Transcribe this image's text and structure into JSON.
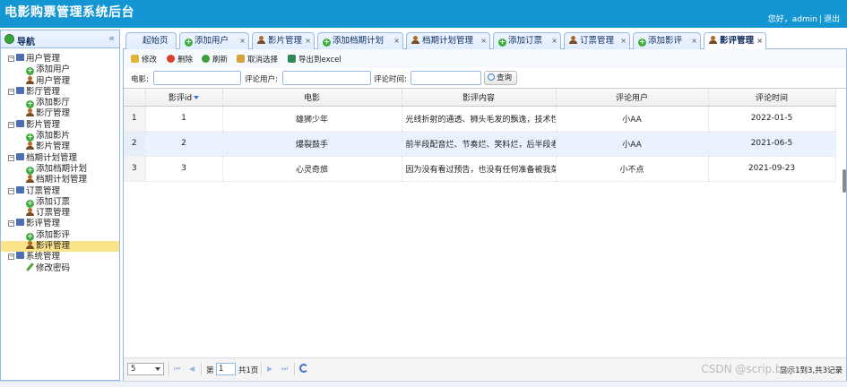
{
  "header": {
    "app_title": "电影购票管理系统后台",
    "greeting": "您好，",
    "username": "admin",
    "separator": "|",
    "logout": "退出"
  },
  "sidebar": {
    "title": "导航",
    "collapse_glyph": "«",
    "groups": [
      {
        "label": "用户管理",
        "items": [
          {
            "label": "添加用户",
            "icon": "add-icon"
          },
          {
            "label": "用户管理",
            "icon": "user-icon"
          }
        ]
      },
      {
        "label": "影厅管理",
        "items": [
          {
            "label": "添加影厅",
            "icon": "add-icon"
          },
          {
            "label": "影厅管理",
            "icon": "user-icon"
          }
        ]
      },
      {
        "label": "影片管理",
        "items": [
          {
            "label": "添加影片",
            "icon": "add-icon"
          },
          {
            "label": "影片管理",
            "icon": "user-icon"
          }
        ]
      },
      {
        "label": "档期计划管理",
        "items": [
          {
            "label": "添加档期计划",
            "icon": "add-icon"
          },
          {
            "label": "档期计划管理",
            "icon": "user-icon"
          }
        ]
      },
      {
        "label": "订票管理",
        "items": [
          {
            "label": "添加订票",
            "icon": "add-icon"
          },
          {
            "label": "订票管理",
            "icon": "user-icon"
          }
        ]
      },
      {
        "label": "影评管理",
        "items": [
          {
            "label": "添加影评",
            "icon": "add-icon"
          },
          {
            "label": "影评管理",
            "icon": "user-icon",
            "selected": true
          }
        ]
      },
      {
        "label": "系统管理",
        "items": [
          {
            "label": "修改密码",
            "icon": "pencil-icon"
          }
        ]
      }
    ]
  },
  "tabs": [
    {
      "label": "起始页",
      "icon": "none",
      "closable": false
    },
    {
      "label": "添加用户",
      "icon": "add-icon",
      "closable": true
    },
    {
      "label": "影片管理",
      "icon": "user-icon",
      "closable": true
    },
    {
      "label": "添加档期计划",
      "icon": "add-icon",
      "closable": true
    },
    {
      "label": "档期计划管理",
      "icon": "user-icon",
      "closable": true
    },
    {
      "label": "添加订票",
      "icon": "add-icon",
      "closable": true
    },
    {
      "label": "订票管理",
      "icon": "user-icon",
      "closable": true
    },
    {
      "label": "添加影评",
      "icon": "add-icon",
      "closable": true
    },
    {
      "label": "影评管理",
      "icon": "user-icon",
      "closable": true,
      "active": true
    }
  ],
  "tab_close_glyph": "×",
  "toolbar": {
    "edit": "修改",
    "delete": "删除",
    "refresh": "刷新",
    "cancel_select": "取消选择",
    "export": "导出到excel"
  },
  "search": {
    "movie_label": "电影:",
    "user_label": "评论用户:",
    "time_label": "评论时间:",
    "movie_value": "",
    "user_value": "",
    "time_value": "",
    "query_button": "查询"
  },
  "grid": {
    "columns": [
      "影评id",
      "电影",
      "影评内容",
      "评论用户",
      "评论时间"
    ],
    "rows": [
      {
        "rownum": "1",
        "id": "1",
        "movie": "雄狮少年",
        "content": "光线折射的通透、狮头毛发的飘逸，技术性",
        "user": "小AA",
        "time": "2022-01-5"
      },
      {
        "rownum": "2",
        "id": "2",
        "movie": "爆裂鼓手",
        "content": "前半段配音烂、节奏烂、笑料烂，后半段老",
        "user": "小AA",
        "time": "2021-06-5"
      },
      {
        "rownum": "3",
        "id": "3",
        "movie": "心灵奇旅",
        "content": "因为没有看过预告，也没有任何准备被我菜",
        "user": "小不点",
        "time": "2021-09-23"
      }
    ]
  },
  "pager": {
    "page_size": "5",
    "page_prefix": "第",
    "page_value": "1",
    "page_total": "共1页",
    "info": "显示1到3,共3记录",
    "first": "⏮",
    "prev": "◀",
    "next": "▶",
    "last": "⏭"
  },
  "watermark": "CSDN @scrip.boy"
}
